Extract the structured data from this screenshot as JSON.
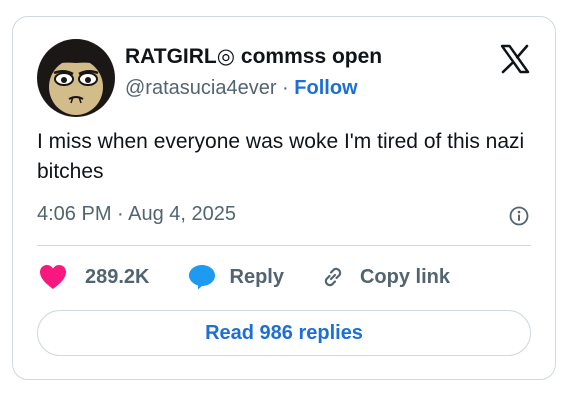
{
  "author": {
    "display_name": "RATGIRL◎ commss open",
    "handle": "@ratasucia4ever",
    "separator": "·",
    "follow_label": "Follow"
  },
  "tweet": {
    "text": "I miss when everyone was woke I'm tired of this nazi bitches",
    "timestamp": "4:06 PM · Aug 4, 2025"
  },
  "actions": {
    "like_count": "289.2K",
    "reply_label": "Reply",
    "copy_link_label": "Copy link"
  },
  "read_replies_label": "Read 986 replies",
  "icons": {
    "brand": "x-logo-icon",
    "info": "info-icon",
    "like": "heart-icon",
    "reply": "speech-bubble-icon",
    "copy": "link-icon"
  },
  "colors": {
    "link_blue": "#1d6fd8",
    "heart_pink": "#f91880",
    "reply_blue": "#1d9bf0",
    "text_gray": "#536471",
    "border": "#cfd9de"
  }
}
